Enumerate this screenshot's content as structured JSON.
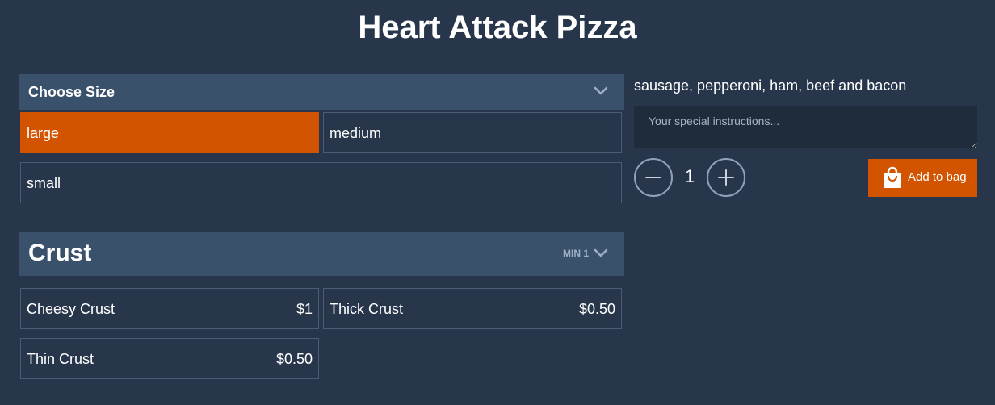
{
  "header": {
    "title": "Heart Attack Pizza"
  },
  "size_section": {
    "title": "Choose Size",
    "icon": "chevron-down-icon",
    "options": [
      {
        "label": "large",
        "selected": true
      },
      {
        "label": "medium",
        "selected": false
      },
      {
        "label": "small",
        "selected": false
      }
    ]
  },
  "crust_section": {
    "title": "Crust",
    "min_badge": "MIN 1",
    "icon": "chevron-down-icon",
    "options": [
      {
        "label": "Cheesy Crust",
        "price": "$1"
      },
      {
        "label": "Thick Crust",
        "price": "$0.50"
      },
      {
        "label": "Thin Crust",
        "price": "$0.50"
      }
    ]
  },
  "item": {
    "description": "sausage, pepperoni, ham, beef and bacon",
    "instructions_placeholder": "Your special instructions...",
    "instructions_value": ""
  },
  "quantity": {
    "value": "1",
    "decrement_icon": "minus-icon",
    "increment_icon": "plus-icon"
  },
  "add_to_bag": {
    "label": "Add to bag",
    "icon": "shopping-bag-icon"
  },
  "colors": {
    "background": "#27364a",
    "header_bar": "#3a516c",
    "accent": "#d35400",
    "border": "#4a5d75",
    "input_bg": "#1f2c3b",
    "muted_text": "#9fb0c4"
  }
}
